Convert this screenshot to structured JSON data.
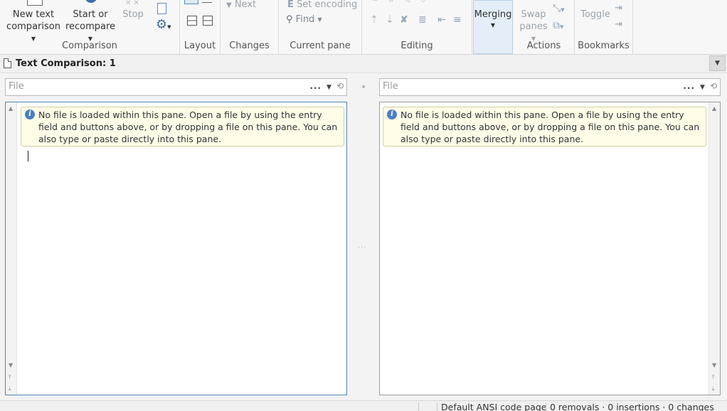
{
  "ribbon": {
    "groups": {
      "comparison": {
        "label": "Comparison",
        "new_text_line1": "New text",
        "new_text_line2": "comparison",
        "start_line1": "Start or",
        "start_line2": "recompare",
        "stop": "Stop"
      },
      "layout": {
        "label": "Layout"
      },
      "changes": {
        "label": "Changes",
        "next": "Next"
      },
      "current_pane": {
        "label": "Current pane",
        "set_encoding": "Set encoding",
        "find": "Find"
      },
      "editing": {
        "label": "Editing"
      },
      "merging": {
        "label": "Merging"
      },
      "actions": {
        "label": "Actions",
        "swap_line1": "Swap",
        "swap_line2": "panes"
      },
      "bookmarks": {
        "label": "Bookmarks",
        "toggle": "Toggle"
      }
    }
  },
  "tab": {
    "title": "Text Comparison: 1"
  },
  "left_pane": {
    "file_placeholder": "File",
    "notice": "No file is loaded within this pane. Open a file by using the entry field and buttons above, or by dropping a file on this pane. You can also type or paste directly into this pane."
  },
  "right_pane": {
    "file_placeholder": "File",
    "notice": "No file is loaded within this pane. Open a file by using the entry field and buttons above, or by dropping a file on this pane. You can also type or paste directly into this pane."
  },
  "filebar_tools": {
    "browse": "...",
    "dropdown": "▼",
    "history": "⟲"
  },
  "status": {
    "code_page": "Default ANSI code page",
    "summary": "0 removals · 0 insertions · 0 changes"
  },
  "colors": {
    "accent": "#4a7fc0",
    "notice_bg": "#fffde8",
    "merging_bg": "#e4eef8"
  }
}
